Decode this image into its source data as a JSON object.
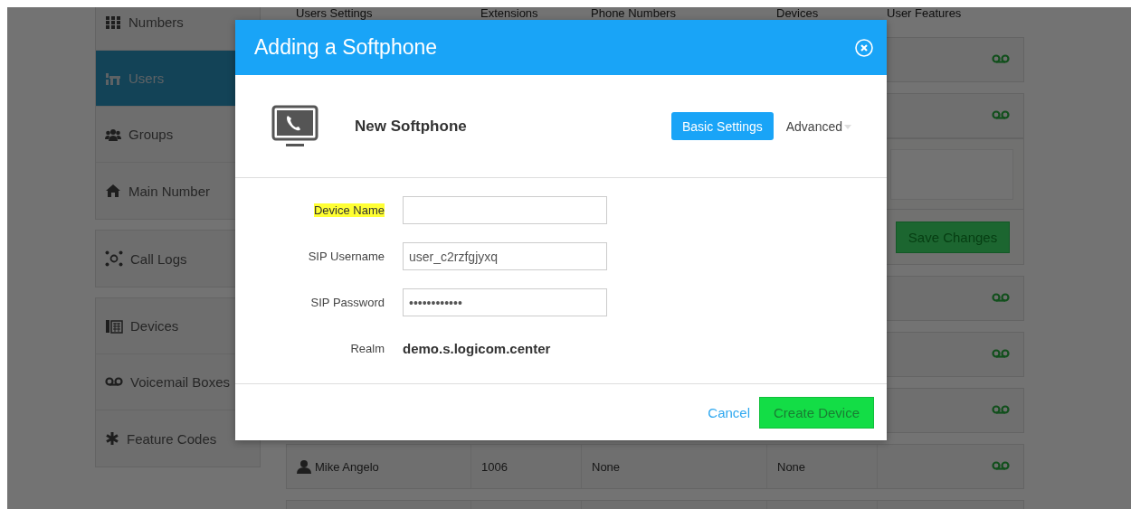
{
  "sidebar": {
    "groups": [
      {
        "items": [
          {
            "label": "Numbers",
            "selected": false
          },
          {
            "label": "Users",
            "selected": true
          },
          {
            "label": "Groups",
            "selected": false
          },
          {
            "label": "Main Number",
            "selected": false
          }
        ]
      },
      {
        "items": [
          {
            "label": "Call Logs",
            "selected": false
          }
        ]
      },
      {
        "items": [
          {
            "label": "Devices",
            "selected": false
          },
          {
            "label": "Voicemail Boxes",
            "selected": false
          },
          {
            "label": "Feature Codes",
            "selected": false
          }
        ]
      }
    ]
  },
  "table": {
    "columns": [
      "Users Settings",
      "Extensions",
      "Phone Numbers",
      "Devices",
      "User Features"
    ],
    "rows": [
      {
        "kind": "summary"
      },
      {
        "kind": "summary"
      },
      {
        "kind": "editor",
        "button": "Save Changes"
      },
      {
        "kind": "summary"
      },
      {
        "kind": "summary"
      },
      {
        "kind": "summary"
      },
      {
        "kind": "summary",
        "cells": [
          "Mike Angelo",
          "1006",
          "None",
          "None"
        ]
      },
      {
        "kind": "summary"
      }
    ]
  },
  "dialog": {
    "title": "Adding a Softphone",
    "device_title": "New Softphone",
    "tabs": [
      {
        "label": "Basic Settings",
        "selected": true,
        "dropdown": false
      },
      {
        "label": "Advanced",
        "selected": false,
        "dropdown": true
      }
    ],
    "fields": [
      {
        "kind": "input",
        "label": "Device Name",
        "highlighted": true
      },
      {
        "kind": "input",
        "label": "SIP Username",
        "value": "user_c2rzfgjyxq",
        "highlighted": false
      },
      {
        "kind": "input",
        "label": "SIP Password",
        "value": "••••••••••••",
        "highlighted": false
      },
      {
        "kind": "static",
        "label": "Realm",
        "value": "demo.s.logicom.center",
        "highlighted": false
      }
    ],
    "buttons": [
      {
        "kind": "link",
        "label": "Cancel"
      },
      {
        "kind": "primary",
        "label": "Create Device"
      }
    ]
  }
}
